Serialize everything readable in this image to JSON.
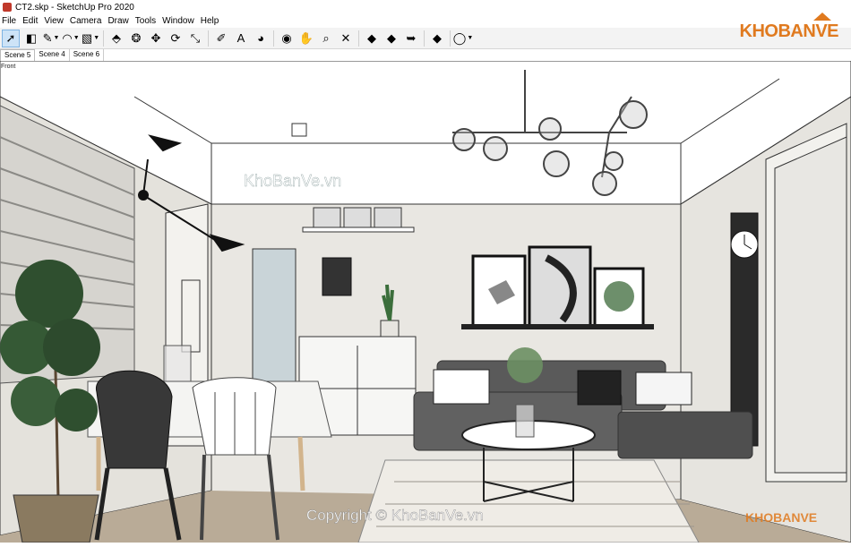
{
  "window": {
    "title": "CT2.skp - SketchUp Pro 2020"
  },
  "menu": [
    "File",
    "Edit",
    "View",
    "Camera",
    "Draw",
    "Tools",
    "Window",
    "Help"
  ],
  "toolbar": {
    "tools": [
      {
        "name": "select-tool-icon",
        "glyph": "➚",
        "selected": true
      },
      {
        "name": "eraser-tool-icon",
        "glyph": "◧"
      },
      {
        "name": "pencil-tool-icon",
        "glyph": "✎",
        "dropdown": true
      },
      {
        "name": "arc-tool-icon",
        "glyph": "◠",
        "dropdown": true
      },
      {
        "name": "shape-tool-icon",
        "glyph": "▧",
        "dropdown": true
      },
      {
        "name": "push-pull-tool-icon",
        "glyph": "⬘"
      },
      {
        "name": "offset-tool-icon",
        "glyph": "❂"
      },
      {
        "name": "move-tool-icon",
        "glyph": "✥"
      },
      {
        "name": "rotate-tool-icon",
        "glyph": "⟳"
      },
      {
        "name": "scale-tool-icon",
        "glyph": "⤡"
      },
      {
        "name": "tape-measure-icon",
        "glyph": "✐"
      },
      {
        "name": "text-tool-icon",
        "glyph": "A"
      },
      {
        "name": "paint-bucket-icon",
        "glyph": "◕"
      },
      {
        "name": "orbit-tool-icon",
        "glyph": "◉"
      },
      {
        "name": "pan-tool-icon",
        "glyph": "✋"
      },
      {
        "name": "zoom-tool-icon",
        "glyph": "⌕"
      },
      {
        "name": "zoom-extents-icon",
        "glyph": "✕"
      },
      {
        "name": "warehouse-icon",
        "glyph": "◆"
      },
      {
        "name": "extension-warehouse-icon",
        "glyph": "◆"
      },
      {
        "name": "send-to-layout-icon",
        "glyph": "➥"
      },
      {
        "name": "ruby-extension-icon",
        "glyph": "◆"
      },
      {
        "name": "account-icon",
        "glyph": "◯",
        "dropdown": true
      }
    ]
  },
  "brand": {
    "logo_text": "KHOBANVE"
  },
  "scene_tabs": [
    {
      "label": "Scene 5",
      "active": true
    },
    {
      "label": "Scene 4"
    },
    {
      "label": "Scene 6"
    }
  ],
  "view_label": "Front",
  "watermarks": {
    "center": "KhoBanVe.vn",
    "bottom": "Copyright © KhoBanVe.vn",
    "corner": "KHOBANVE"
  },
  "colors": {
    "accent_orange": "#e07a1f",
    "wall": "#e9e7e2",
    "floor": "#b9ab97",
    "sofa": "#5a5a5a"
  }
}
